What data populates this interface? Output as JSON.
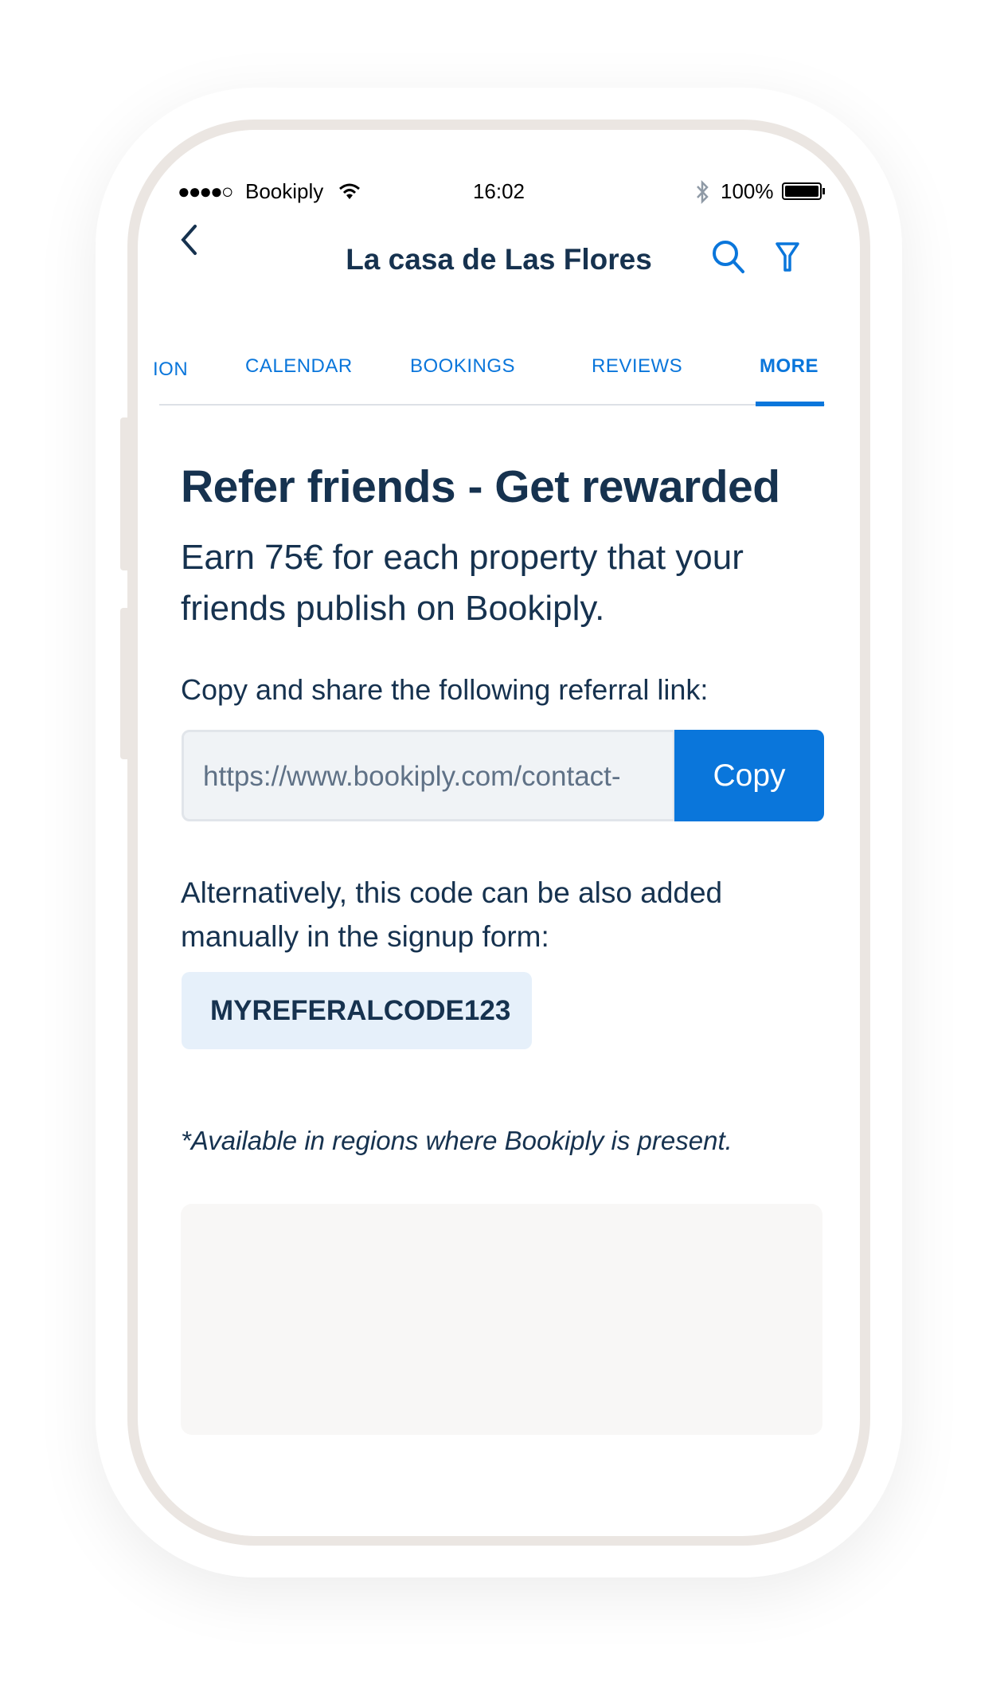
{
  "status_bar": {
    "carrier": "Bookiply",
    "time": "16:02",
    "battery": "100%"
  },
  "header": {
    "title": "La casa de Las Flores"
  },
  "tabs": [
    {
      "label": "ION",
      "active": false
    },
    {
      "label": "CALENDAR",
      "active": false
    },
    {
      "label": "BOOKINGS",
      "active": false
    },
    {
      "label": "REVIEWS",
      "active": false
    },
    {
      "label": "MORE",
      "active": true
    }
  ],
  "main": {
    "heading": "Refer friends - Get rewarded",
    "lead": "Earn 75€ for each property that your friends publish on Bookiply.",
    "link_label": "Copy and share the following referral link:",
    "link_value": "https://www.bookiply.com/contact-",
    "copy_label": "Copy",
    "alt_text": "Alternatively, this code can be also added manually in the signup form:",
    "code": "MYREFERALCODE123",
    "note": "*Available in regions where Bookiply is present."
  },
  "colors": {
    "accent": "#0a76db",
    "text": "#16324f",
    "frame": "#ebe6e2"
  }
}
